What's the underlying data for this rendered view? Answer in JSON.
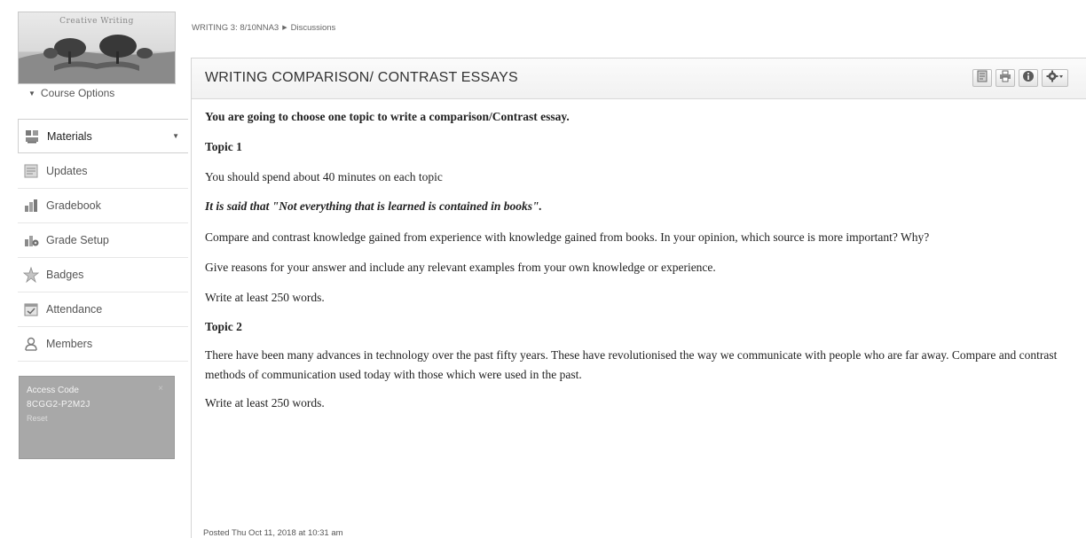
{
  "sidebar": {
    "logo": {
      "title": "Creative Writing"
    },
    "course_options_label": "Course Options",
    "items": [
      {
        "label": "Materials",
        "icon": "materials-icon",
        "active": true
      },
      {
        "label": "Updates",
        "icon": "updates-icon"
      },
      {
        "label": "Gradebook",
        "icon": "gradebook-icon"
      },
      {
        "label": "Grade Setup",
        "icon": "grade-setup-icon"
      },
      {
        "label": "Badges",
        "icon": "badges-icon"
      },
      {
        "label": "Attendance",
        "icon": "attendance-icon"
      },
      {
        "label": "Members",
        "icon": "members-icon"
      }
    ],
    "access": {
      "label": "Access Code",
      "code": "8CGG2-P2M2J",
      "reset_label": "Reset",
      "close_label": "×"
    }
  },
  "breadcrumb": {
    "course": "WRITING 3: 8/10NNA3",
    "page": "Discussions"
  },
  "discussion": {
    "title": "WRITING COMPARISON/ CONTRAST ESSAYS",
    "body": [
      "You are going to choose one topic to write a comparison/Contrast essay.",
      "Topic 1",
      "You should spend about 40 minutes on each topic",
      "It is said that \"Not everything that is learned is contained in books\".",
      "Compare and contrast knowledge gained from experience with knowledge gained from books. In your opinion, which source is more important? Why?",
      "Give reasons for your answer and include any relevant examples from your own knowledge or experience.",
      "Write at least 250 words.",
      "Topic 2",
      "There have been many advances in technology over the past fifty years. These have revolutionised the way we communicate with people who are far away. Compare and contrast methods of communication used today with those which were used in the past.",
      "Write at least 250 words."
    ],
    "posted": "Posted Thu Oct 11, 2018 at 10:31 am"
  },
  "toolbar": {
    "icons": [
      "document-icon",
      "print-icon",
      "info-icon",
      "gear-icon"
    ]
  },
  "colors": {
    "access_box_bg": "#a8a8a8",
    "header_bg": "#f1f1f1"
  }
}
